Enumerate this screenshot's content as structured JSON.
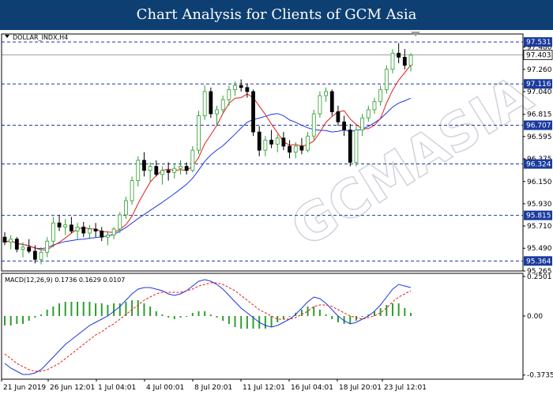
{
  "banner": {
    "title": "Chart Analysis for Clients of GCM Asia"
  },
  "watermark": "GCMASIA",
  "chart_data": {
    "type": "candlestick",
    "symbol_label": "DOLLAR_INDX,H4",
    "indicator_label": "MACD(12,26,9) 0.1736 0.1629 0.0107",
    "x_tick_labels": [
      "21 Jun 2019",
      "26 Jun 12:01",
      "1 Jul 04:01",
      "4 Jul 00:01",
      "8 Jul 20:01",
      "11 Jul 12:01",
      "16 Jul 04:01",
      "18 Jul 20:01",
      "23 Jul 12:01"
    ],
    "price_axis": {
      "ylim": [
        95.265,
        97.61
      ],
      "tick_labels": [
        "95.265",
        "95.490",
        "95.710",
        "95.930",
        "96.150",
        "96.375",
        "96.595",
        "96.815",
        "97.040",
        "97.260",
        "97.480"
      ]
    },
    "levels": [
      {
        "value": 97.531,
        "label": "97.531"
      },
      {
        "value": 97.116,
        "label": "97.116"
      },
      {
        "value": 96.707,
        "label": "96.707"
      },
      {
        "value": 96.324,
        "label": "96.324"
      },
      {
        "value": 95.815,
        "label": "95.815"
      },
      {
        "value": 95.364,
        "label": "95.364"
      }
    ],
    "current_price": {
      "value": 97.403,
      "label": "97.403"
    },
    "macd_axis": {
      "ylim": [
        -0.4,
        0.27
      ],
      "tick_labels": [
        {
          "value": 0.2501,
          "label": "0.2501"
        },
        {
          "value": 0.0,
          "label": "0.00"
        },
        {
          "value": -0.3735,
          "label": "-0.3735"
        }
      ]
    },
    "colors": {
      "bull": "#2e9e2e",
      "bear": "#000000",
      "ma_fast": "#e0201e",
      "ma_slow": "#2035e0",
      "macd_line": "#2035e0",
      "signal_line": "#e0201e",
      "histogram": "#2e9e2e",
      "level_line": "#1a3a9e"
    },
    "candles": [
      [
        95.6,
        95.65,
        95.52,
        95.55
      ],
      [
        95.55,
        95.62,
        95.48,
        95.58
      ],
      [
        95.58,
        95.6,
        95.45,
        95.48
      ],
      [
        95.48,
        95.55,
        95.4,
        95.5
      ],
      [
        95.5,
        95.58,
        95.44,
        95.46
      ],
      [
        95.46,
        95.52,
        95.34,
        95.38
      ],
      [
        95.38,
        95.5,
        95.33,
        95.45
      ],
      [
        95.45,
        95.6,
        95.4,
        95.56
      ],
      [
        95.56,
        95.8,
        95.5,
        95.74
      ],
      [
        95.74,
        95.82,
        95.66,
        95.7
      ],
      [
        95.7,
        95.78,
        95.62,
        95.72
      ],
      [
        95.72,
        95.8,
        95.64,
        95.66
      ],
      [
        95.66,
        95.74,
        95.58,
        95.7
      ],
      [
        95.7,
        95.75,
        95.6,
        95.64
      ],
      [
        95.64,
        95.72,
        95.58,
        95.68
      ],
      [
        95.68,
        95.74,
        95.6,
        95.66
      ],
      [
        95.66,
        95.7,
        95.56,
        95.6
      ],
      [
        95.6,
        95.66,
        95.52,
        95.62
      ],
      [
        95.62,
        95.7,
        95.58,
        95.68
      ],
      [
        95.68,
        95.85,
        95.64,
        95.82
      ],
      [
        95.82,
        96.0,
        95.78,
        95.96
      ],
      [
        95.96,
        96.2,
        95.92,
        96.16
      ],
      [
        96.16,
        96.4,
        96.1,
        96.36
      ],
      [
        96.36,
        96.44,
        96.2,
        96.26
      ],
      [
        96.26,
        96.34,
        96.14,
        96.3
      ],
      [
        96.3,
        96.36,
        96.2,
        96.22
      ],
      [
        96.22,
        96.3,
        96.12,
        96.26
      ],
      [
        96.26,
        96.34,
        96.16,
        96.24
      ],
      [
        96.24,
        96.32,
        96.18,
        96.28
      ],
      [
        96.28,
        96.36,
        96.22,
        96.3
      ],
      [
        96.3,
        96.34,
        96.22,
        96.26
      ],
      [
        96.26,
        96.5,
        96.24,
        96.46
      ],
      [
        96.46,
        96.85,
        96.42,
        96.8
      ],
      [
        96.8,
        97.1,
        96.76,
        97.04
      ],
      [
        97.04,
        97.08,
        96.78,
        96.82
      ],
      [
        96.82,
        96.9,
        96.7,
        96.86
      ],
      [
        96.86,
        97.0,
        96.82,
        96.96
      ],
      [
        96.96,
        97.1,
        96.9,
        97.06
      ],
      [
        97.06,
        97.14,
        97.0,
        97.1
      ],
      [
        97.1,
        97.16,
        97.04,
        97.08
      ],
      [
        97.08,
        97.12,
        96.98,
        97.04
      ],
      [
        97.04,
        97.06,
        96.6,
        96.64
      ],
      [
        96.64,
        96.7,
        96.4,
        96.46
      ],
      [
        96.46,
        96.6,
        96.4,
        96.56
      ],
      [
        96.56,
        96.66,
        96.48,
        96.52
      ],
      [
        96.52,
        96.62,
        96.44,
        96.58
      ],
      [
        96.58,
        96.64,
        96.46,
        96.5
      ],
      [
        96.5,
        96.56,
        96.38,
        96.44
      ],
      [
        96.44,
        96.54,
        96.38,
        96.5
      ],
      [
        96.5,
        96.58,
        96.42,
        96.46
      ],
      [
        96.46,
        96.64,
        96.44,
        96.6
      ],
      [
        96.6,
        96.86,
        96.56,
        96.82
      ],
      [
        96.82,
        97.04,
        96.78,
        97.0
      ],
      [
        97.0,
        97.08,
        96.94,
        97.04
      ],
      [
        97.04,
        97.06,
        96.8,
        96.84
      ],
      [
        96.84,
        96.9,
        96.7,
        96.74
      ],
      [
        96.74,
        96.8,
        96.6,
        96.66
      ],
      [
        96.66,
        96.72,
        96.3,
        96.34
      ],
      [
        96.34,
        96.7,
        96.3,
        96.66
      ],
      [
        96.66,
        96.82,
        96.6,
        96.78
      ],
      [
        96.78,
        96.9,
        96.74,
        96.86
      ],
      [
        96.86,
        96.98,
        96.82,
        96.94
      ],
      [
        96.94,
        97.1,
        96.9,
        97.06
      ],
      [
        97.06,
        97.3,
        97.02,
        97.26
      ],
      [
        97.26,
        97.46,
        97.22,
        97.42
      ],
      [
        97.42,
        97.52,
        97.32,
        97.38
      ],
      [
        97.38,
        97.46,
        97.26,
        97.3
      ],
      [
        97.3,
        97.42,
        97.24,
        97.4
      ]
    ],
    "macd": [
      -0.3,
      -0.33,
      -0.35,
      -0.37,
      -0.37,
      -0.36,
      -0.34,
      -0.3,
      -0.26,
      -0.22,
      -0.18,
      -0.15,
      -0.12,
      -0.09,
      -0.06,
      -0.04,
      -0.02,
      0.0,
      0.03,
      0.06,
      0.1,
      0.14,
      0.17,
      0.18,
      0.18,
      0.17,
      0.16,
      0.14,
      0.13,
      0.14,
      0.16,
      0.19,
      0.22,
      0.23,
      0.22,
      0.2,
      0.17,
      0.13,
      0.09,
      0.05,
      0.02,
      -0.01,
      -0.04,
      -0.06,
      -0.07,
      -0.06,
      -0.04,
      -0.02,
      0.01,
      0.05,
      0.09,
      0.12,
      0.11,
      0.08,
      0.04,
      0.0,
      -0.03,
      -0.05,
      -0.04,
      -0.02,
      0.0,
      0.03,
      0.07,
      0.12,
      0.17,
      0.2,
      0.19,
      0.18
    ],
    "signal": [
      -0.24,
      -0.27,
      -0.3,
      -0.32,
      -0.34,
      -0.35,
      -0.35,
      -0.34,
      -0.32,
      -0.3,
      -0.27,
      -0.24,
      -0.21,
      -0.18,
      -0.15,
      -0.12,
      -0.1,
      -0.07,
      -0.05,
      -0.02,
      0.01,
      0.04,
      0.07,
      0.1,
      0.12,
      0.14,
      0.15,
      0.15,
      0.15,
      0.15,
      0.16,
      0.17,
      0.19,
      0.2,
      0.21,
      0.21,
      0.2,
      0.18,
      0.16,
      0.13,
      0.1,
      0.07,
      0.04,
      0.02,
      0.0,
      -0.02,
      -0.02,
      -0.02,
      -0.01,
      0.01,
      0.03,
      0.06,
      0.07,
      0.07,
      0.06,
      0.04,
      0.02,
      0.0,
      -0.01,
      -0.02,
      -0.01,
      0.0,
      0.02,
      0.05,
      0.09,
      0.12,
      0.14,
      0.16
    ]
  }
}
